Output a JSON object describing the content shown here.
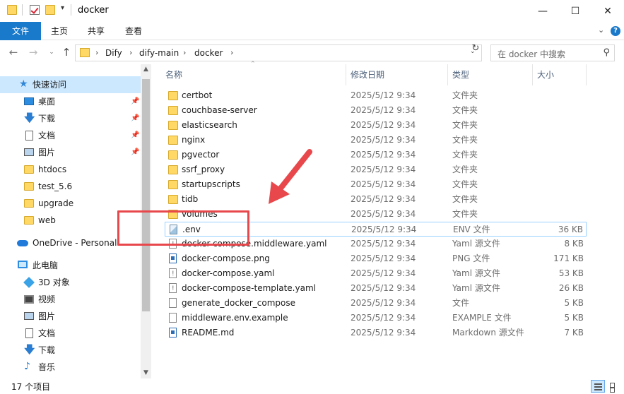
{
  "window": {
    "title": "docker",
    "minimize": "—",
    "maximize": "☐",
    "close": "✕"
  },
  "ribbon": {
    "tabs": [
      "文件",
      "主页",
      "共享",
      "查看"
    ]
  },
  "address": {
    "crumbs": [
      "Dify",
      "dify-main",
      "docker"
    ],
    "separator": "›",
    "search_placeholder": "在 docker 中搜索"
  },
  "sidebar": {
    "items": [
      {
        "label": "快速访问",
        "icon": "star-icon",
        "pinned": false,
        "selected": true
      },
      {
        "label": "桌面",
        "icon": "desktop-icon",
        "pinned": true
      },
      {
        "label": "下载",
        "icon": "download-icon",
        "pinned": true
      },
      {
        "label": "文档",
        "icon": "document-icon",
        "pinned": true
      },
      {
        "label": "图片",
        "icon": "picture-icon",
        "pinned": true
      },
      {
        "label": "htdocs",
        "icon": "folder-icon"
      },
      {
        "label": "test_5.6",
        "icon": "folder-icon"
      },
      {
        "label": "upgrade",
        "icon": "folder-icon"
      },
      {
        "label": "web",
        "icon": "folder-icon"
      },
      {
        "label": "OneDrive - Personal",
        "icon": "onedrive-icon"
      },
      {
        "label": "此电脑",
        "icon": "this-pc-icon"
      },
      {
        "label": "3D 对象",
        "icon": "3d-objects-icon"
      },
      {
        "label": "视频",
        "icon": "video-icon"
      },
      {
        "label": "图片",
        "icon": "picture-icon"
      },
      {
        "label": "文档",
        "icon": "document-icon"
      },
      {
        "label": "下载",
        "icon": "download-icon"
      },
      {
        "label": "音乐",
        "icon": "music-icon"
      }
    ]
  },
  "columns": {
    "name": "名称",
    "date": "修改日期",
    "type": "类型",
    "size": "大小"
  },
  "files": [
    {
      "name": "certbot",
      "date": "2025/5/12 9:34",
      "type": "文件夹",
      "size": "",
      "icon": "folder"
    },
    {
      "name": "couchbase-server",
      "date": "2025/5/12 9:34",
      "type": "文件夹",
      "size": "",
      "icon": "folder"
    },
    {
      "name": "elasticsearch",
      "date": "2025/5/12 9:34",
      "type": "文件夹",
      "size": "",
      "icon": "folder"
    },
    {
      "name": "nginx",
      "date": "2025/5/12 9:34",
      "type": "文件夹",
      "size": "",
      "icon": "folder"
    },
    {
      "name": "pgvector",
      "date": "2025/5/12 9:34",
      "type": "文件夹",
      "size": "",
      "icon": "folder"
    },
    {
      "name": "ssrf_proxy",
      "date": "2025/5/12 9:34",
      "type": "文件夹",
      "size": "",
      "icon": "folder"
    },
    {
      "name": "startupscripts",
      "date": "2025/5/12 9:34",
      "type": "文件夹",
      "size": "",
      "icon": "folder"
    },
    {
      "name": "tidb",
      "date": "2025/5/12 9:34",
      "type": "文件夹",
      "size": "",
      "icon": "folder"
    },
    {
      "name": "volumes",
      "date": "2025/5/12 9:34",
      "type": "文件夹",
      "size": "",
      "icon": "folder"
    },
    {
      "name": ".env",
      "date": "2025/5/12 9:34",
      "type": "ENV 文件",
      "size": "36 KB",
      "icon": "env",
      "focused": true
    },
    {
      "name": "docker-compose.middleware.yaml",
      "date": "2025/5/12 9:34",
      "type": "Yaml 源文件",
      "size": "8 KB",
      "icon": "yaml"
    },
    {
      "name": "docker-compose.png",
      "date": "2025/5/12 9:34",
      "type": "PNG 文件",
      "size": "171 KB",
      "icon": "png"
    },
    {
      "name": "docker-compose.yaml",
      "date": "2025/5/12 9:34",
      "type": "Yaml 源文件",
      "size": "53 KB",
      "icon": "yaml"
    },
    {
      "name": "docker-compose-template.yaml",
      "date": "2025/5/12 9:34",
      "type": "Yaml 源文件",
      "size": "26 KB",
      "icon": "yaml"
    },
    {
      "name": "generate_docker_compose",
      "date": "2025/5/12 9:34",
      "type": "文件",
      "size": "5 KB",
      "icon": "file"
    },
    {
      "name": "middleware.env.example",
      "date": "2025/5/12 9:34",
      "type": "EXAMPLE 文件",
      "size": "5 KB",
      "icon": "file"
    },
    {
      "name": "README.md",
      "date": "2025/5/12 9:34",
      "type": "Markdown 源文件",
      "size": "7 KB",
      "icon": "md"
    }
  ],
  "status": {
    "item_count": "17 个项目"
  },
  "colors": {
    "accent": "#1979ca",
    "selection": "#cce8ff",
    "annotation": "#e8484b"
  }
}
